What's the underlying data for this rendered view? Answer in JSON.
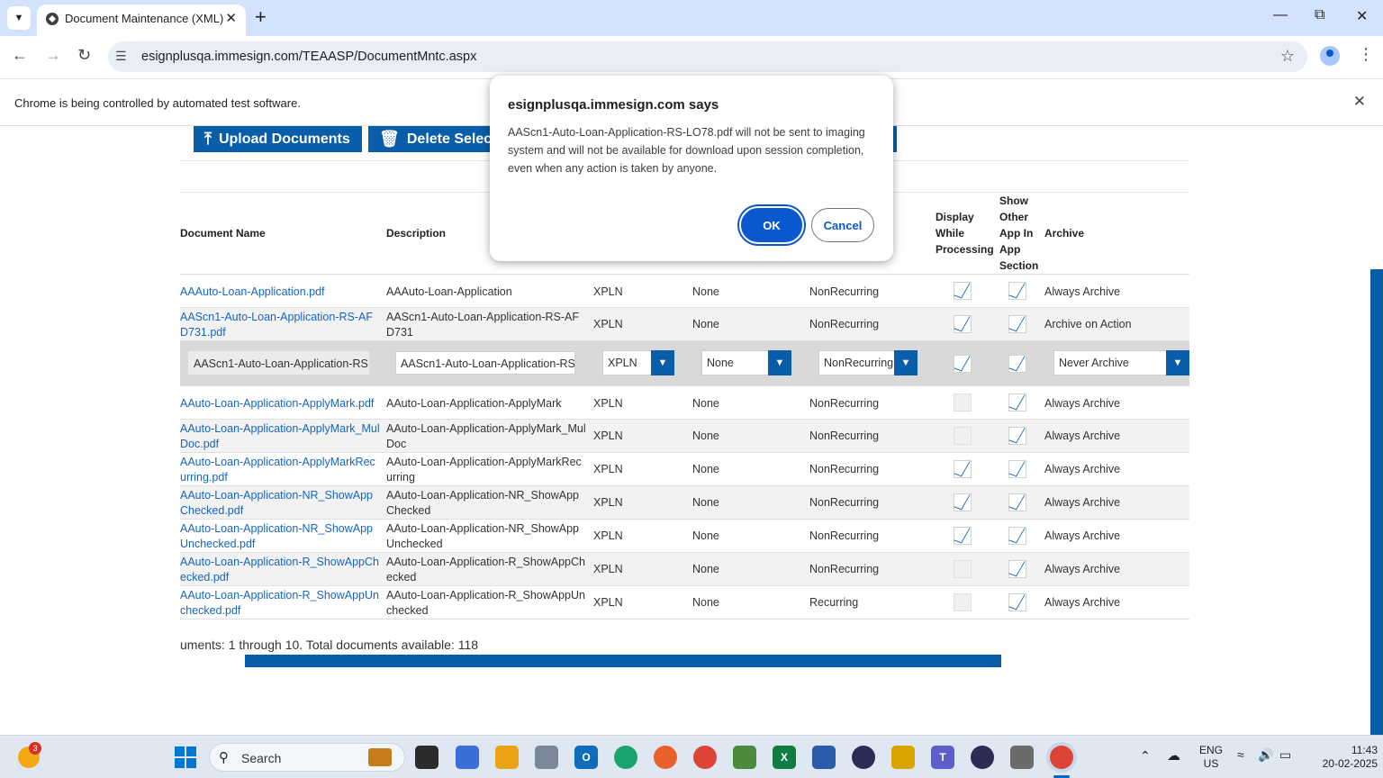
{
  "browser": {
    "tab_title": "Document Maintenance (XML)",
    "url": "esignplusqa.immesign.com/TEAASP/DocumentMntc.aspx",
    "infobar_message": "Chrome is being controlled by automated test software."
  },
  "toolbar": {
    "upload_label": "Upload Documents",
    "delete_label": "Delete Select"
  },
  "table": {
    "headers": {
      "document_name": "Document Name",
      "description": "Description",
      "display_while_processing": "Display While Processing",
      "show_other_app": "Show Other App In App Section",
      "archive": "Archive"
    },
    "rows": [
      {
        "name": "AAAuto-Loan-Application.pdf",
        "desc": "AAAuto-Loan-Application",
        "type": "XPLN",
        "rec": "None",
        "recur": "NonRecurring",
        "display": true,
        "show": true,
        "archive": "Always Archive"
      },
      {
        "name": "AAScn1-Auto-Loan-Application-RS-AFD731.pdf",
        "desc": "AAScn1-Auto-Loan-Application-RS-AFD731",
        "type": "XPLN",
        "rec": "None",
        "recur": "NonRecurring",
        "display": true,
        "show": true,
        "archive": "Archive on Action"
      },
      {
        "name": "AAuto-Loan-Application-ApplyMark.pdf",
        "desc": "AAuto-Loan-Application-ApplyMark",
        "type": "XPLN",
        "rec": "None",
        "recur": "NonRecurring",
        "display": false,
        "show": true,
        "archive": "Always Archive"
      },
      {
        "name": "AAuto-Loan-Application-ApplyMark_MulDoc.pdf",
        "desc": "AAuto-Loan-Application-ApplyMark_MulDoc",
        "type": "XPLN",
        "rec": "None",
        "recur": "NonRecurring",
        "display": false,
        "show": true,
        "archive": "Always Archive"
      },
      {
        "name": "AAuto-Loan-Application-ApplyMarkRecurring.pdf",
        "desc": "AAuto-Loan-Application-ApplyMarkRecurring",
        "type": "XPLN",
        "rec": "None",
        "recur": "NonRecurring",
        "display": true,
        "show": true,
        "archive": "Always Archive"
      },
      {
        "name": "AAuto-Loan-Application-NR_ShowAppChecked.pdf",
        "desc": "AAuto-Loan-Application-NR_ShowAppChecked",
        "type": "XPLN",
        "rec": "None",
        "recur": "NonRecurring",
        "display": true,
        "show": true,
        "archive": "Always Archive"
      },
      {
        "name": "AAuto-Loan-Application-NR_ShowAppUnchecked.pdf",
        "desc": "AAuto-Loan-Application-NR_ShowAppUnchecked",
        "type": "XPLN",
        "rec": "None",
        "recur": "NonRecurring",
        "display": true,
        "show": true,
        "archive": "Always Archive"
      },
      {
        "name": "AAuto-Loan-Application-R_ShowAppChecked.pdf",
        "desc": "AAuto-Loan-Application-R_ShowAppChecked",
        "type": "XPLN",
        "rec": "None",
        "recur": "NonRecurring",
        "display": false,
        "show": true,
        "archive": "Always Archive"
      },
      {
        "name": "AAuto-Loan-Application-R_ShowAppUnchecked.pdf",
        "desc": "AAuto-Loan-Application-R_ShowAppUnchecked",
        "type": "XPLN",
        "rec": "None",
        "recur": "Recurring",
        "display": false,
        "show": true,
        "archive": "Always Archive"
      }
    ],
    "edit_row": {
      "name_value": "AAScn1-Auto-Loan-Application-RS-",
      "desc_value": "AAScn1-Auto-Loan-Application-RS-",
      "type_value": "XPLN",
      "rec_value": "None",
      "recur_value": "NonRecurring",
      "display": true,
      "show": true,
      "archive_value": "Never Archive"
    }
  },
  "footer": {
    "summary": "uments: 1 through 10. Total documents available: 118"
  },
  "dialog": {
    "title": "esignplusqa.immesign.com says",
    "message": "AAScn1-Auto-Loan-Application-RS-LO78.pdf will not be sent to imaging system and will not be available for download upon session completion, even when any action is taken by anyone.",
    "ok_label": "OK",
    "cancel_label": "Cancel"
  },
  "taskbar": {
    "search_label": "Search",
    "weather_badge": "3",
    "lang_top": "ENG",
    "lang_bottom": "US",
    "time": "11:43",
    "date": "20-02-2025"
  },
  "colors": {
    "accent_blue": "#0a5da8",
    "dialog_button": "#0b57d0",
    "link": "#1565c0"
  }
}
